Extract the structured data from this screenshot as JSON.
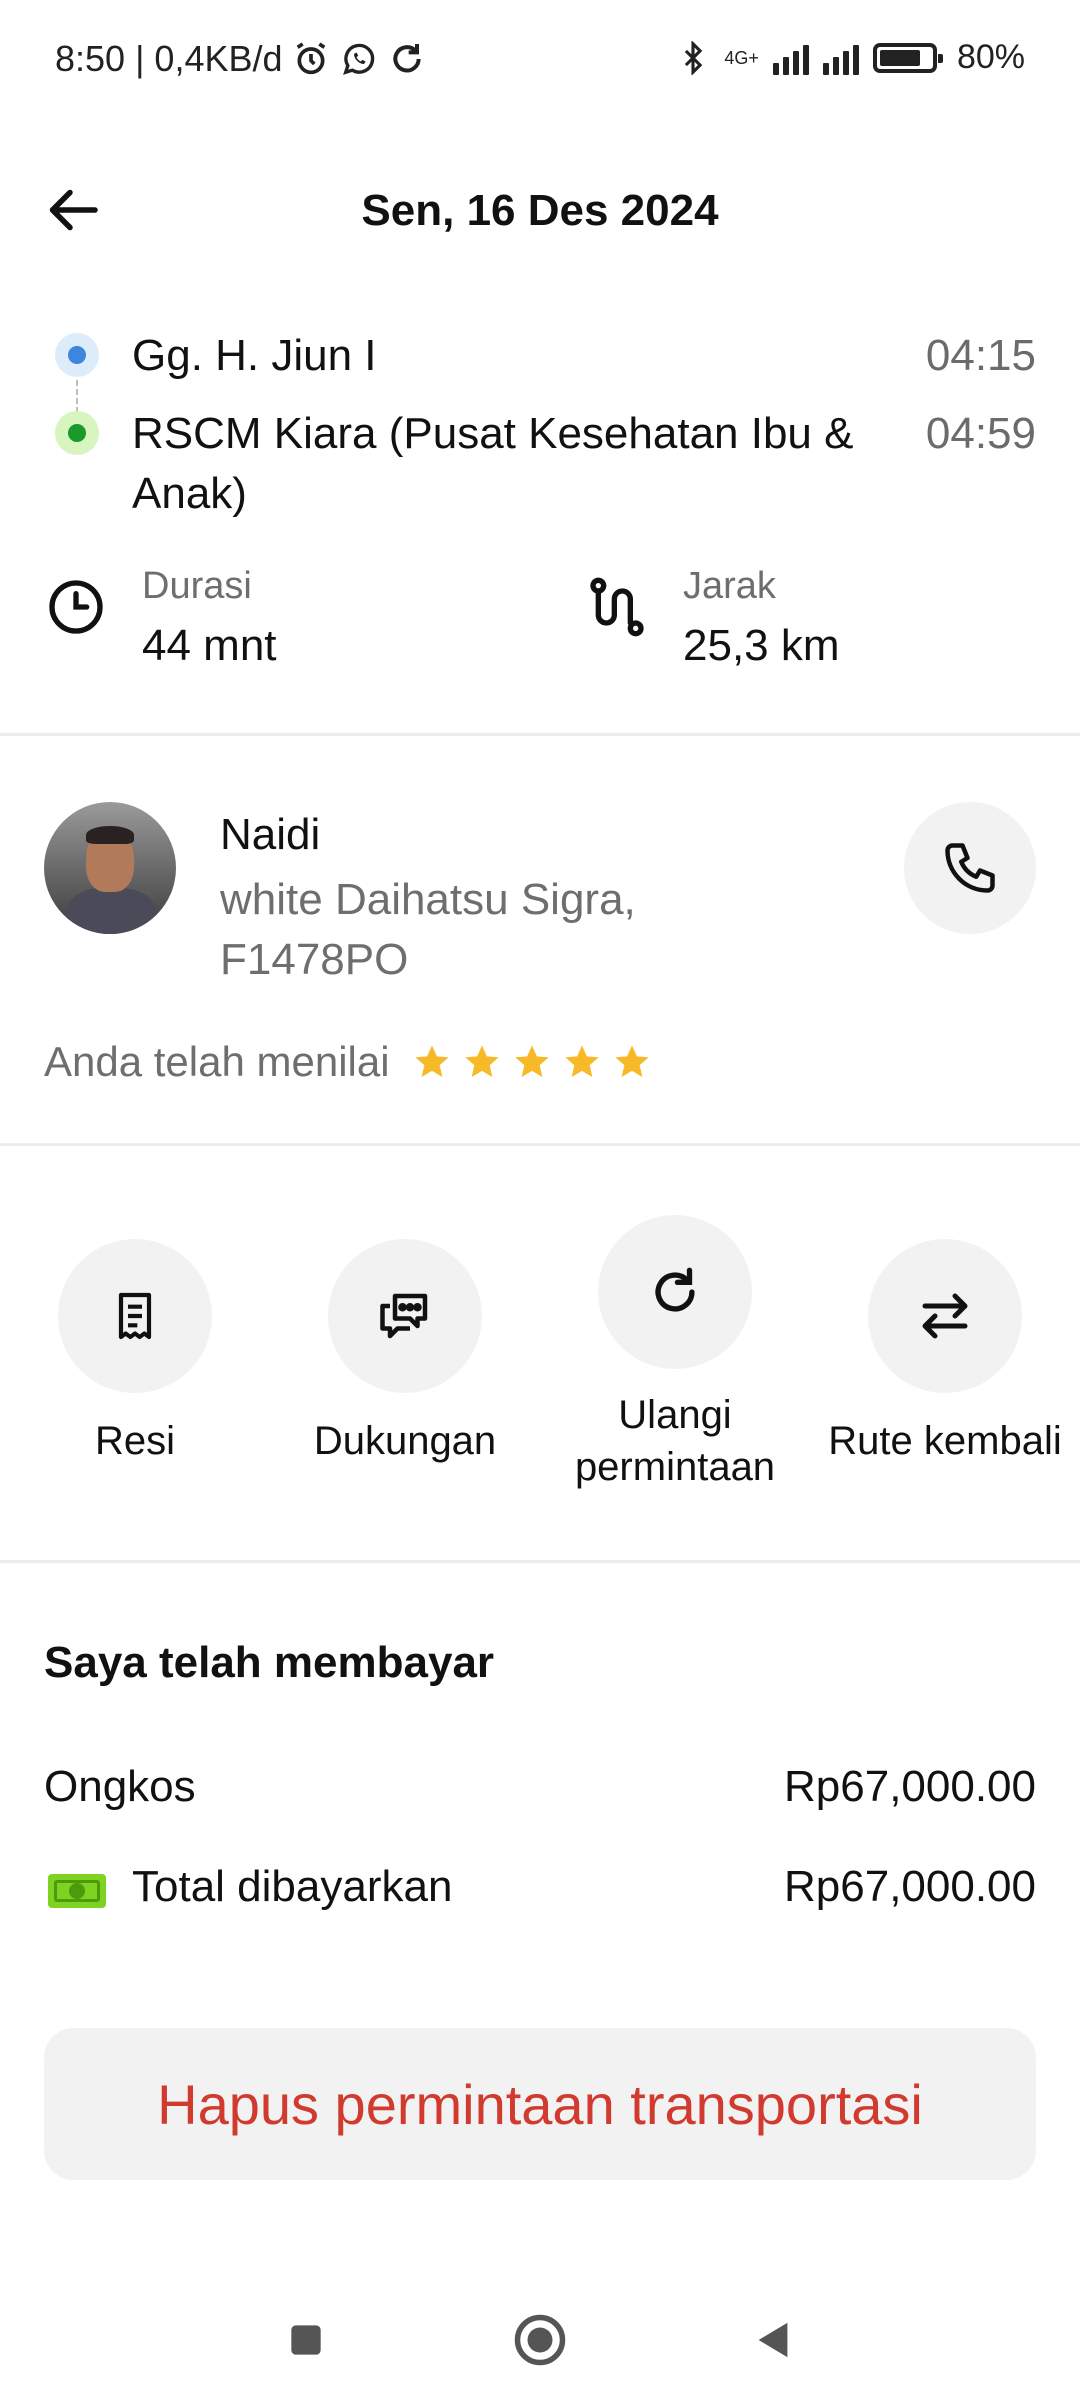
{
  "status_bar": {
    "time_and_speed": "8:50 | 0,4KB/d",
    "network": "4G+",
    "battery": "80%",
    "battery_level": 0.8,
    "icons": [
      "alarm-icon",
      "whatsapp-icon",
      "sync-icon",
      "bluetooth-icon",
      "signal-icon",
      "battery-icon"
    ]
  },
  "header": {
    "title": "Sen, 16 Des 2024",
    "back_icon": "arrow-left-icon"
  },
  "route": {
    "origin": {
      "name": "Gg. H. Jiun I",
      "time": "04:15"
    },
    "destination": {
      "name": "RSCM Kiara (Pusat Kesehatan Ibu & Anak)",
      "time": "04:59"
    }
  },
  "stats": {
    "duration": {
      "label": "Durasi",
      "value": "44 mnt",
      "icon": "clock-icon"
    },
    "distance": {
      "label": "Jarak",
      "value": "25,3 km",
      "icon": "route-icon"
    }
  },
  "driver": {
    "name": "Naidi",
    "car": "white Daihatsu Sigra, F1478PO",
    "rating_label": "Anda telah menilai",
    "rating": 5,
    "rating_max": 5,
    "call_icon": "phone-icon"
  },
  "actions": [
    {
      "label": "Resi",
      "icon": "receipt-icon"
    },
    {
      "label": "Dukungan",
      "icon": "chat-support-icon"
    },
    {
      "label": "Ulangi permintaan",
      "icon": "repeat-icon"
    },
    {
      "label": "Rute kembali",
      "icon": "swap-icon"
    }
  ],
  "payment": {
    "title": "Saya telah membayar",
    "fare_label": "Ongkos",
    "fare_value": "Rp67,000.00",
    "total_label": "Total dibayarkan",
    "total_value": "Rp67,000.00",
    "method_icon": "cash-icon"
  },
  "delete_button": "Hapus permintaan transportasi",
  "colors": {
    "accent_danger": "#d03a2f",
    "star": "#f7b928",
    "origin_dot": "#3d86e0",
    "destination_dot": "#1a9a2a",
    "cash": "#7ed321"
  }
}
